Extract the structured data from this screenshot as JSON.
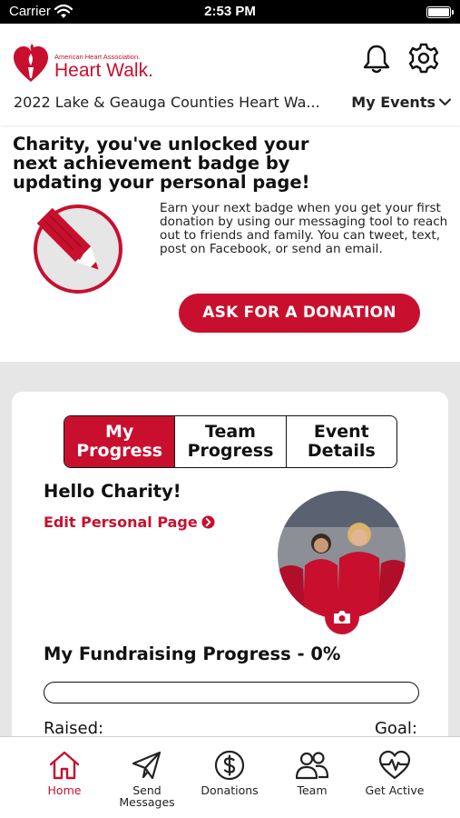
{
  "status_bar": {
    "carrier": "Carrier",
    "time": "2:53 PM"
  },
  "header": {
    "logo": {
      "org": "American Heart Association.",
      "name": "Heart Walk."
    },
    "event_name": "2022 Lake & Geauga Counties Heart Wa...",
    "my_events_label": "My Events",
    "icons": [
      "bell-icon",
      "gear-icon",
      "chevron-down-icon"
    ]
  },
  "banner": {
    "title": "Charity, you've unlocked your next achievement badge by updating your personal page!",
    "body": "Earn your next badge when you get your first donation by using our messaging tool to reach out to friends and family. You can tweet, text, post on Facebook, or send an email.",
    "button_label": "ASK FOR A DONATION",
    "badge_icon": "pencil-heart-badge-icon"
  },
  "progress_card": {
    "tabs": [
      {
        "label": "My Progress",
        "active": true
      },
      {
        "label": "Team Progress",
        "active": false
      },
      {
        "label": "Event Details",
        "active": false
      }
    ],
    "greeting": "Hello Charity!",
    "edit_link_label": "Edit Personal Page",
    "fundraising_title": "My Fundraising Progress - 0%",
    "progress_fraction": 0,
    "raised_label": "Raised:",
    "goal_label": "Goal:"
  },
  "tab_bar": {
    "items": [
      {
        "label": "Home",
        "icon": "home-icon",
        "active": true
      },
      {
        "label": "Send Messages",
        "icon": "paper-plane-icon",
        "active": false
      },
      {
        "label": "Donations",
        "icon": "dollar-circle-icon",
        "active": false
      },
      {
        "label": "Team",
        "icon": "team-icon",
        "active": false
      },
      {
        "label": "Get Active",
        "icon": "heart-pulse-icon",
        "active": false
      }
    ]
  },
  "colors": {
    "accent": "#c8102e",
    "background_gray": "#e6e6e6",
    "text": "#111111"
  }
}
